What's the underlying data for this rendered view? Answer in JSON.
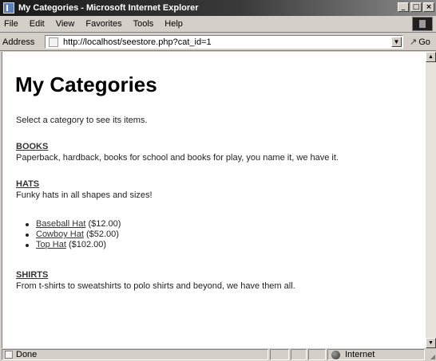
{
  "window": {
    "title": "My Categories - Microsoft Internet Explorer",
    "controls": {
      "minimize": "_",
      "maximize": "□",
      "close": "×"
    }
  },
  "menu": {
    "items": [
      {
        "label": "File"
      },
      {
        "label": "Edit"
      },
      {
        "label": "View"
      },
      {
        "label": "Favorites"
      },
      {
        "label": "Tools"
      },
      {
        "label": "Help"
      }
    ]
  },
  "address_bar": {
    "label": "Address",
    "url": "http://localhost/seestore.php?cat_id=1",
    "go_label": "Go",
    "dropdown_glyph": "▼"
  },
  "page": {
    "title": "My Categories",
    "intro": "Select a category to see its items.",
    "categories": [
      {
        "name": "BOOKS",
        "description": "Paperback, hardback, books for school and books for play, you name it, we have it."
      },
      {
        "name": "HATS",
        "description": "Funky hats in all shapes and sizes!",
        "items": [
          {
            "name": "Baseball Hat",
            "price": "($12.00)"
          },
          {
            "name": "Cowboy Hat",
            "price": "($52.00)"
          },
          {
            "name": "Top Hat",
            "price": "($102.00)"
          }
        ]
      },
      {
        "name": "SHIRTS",
        "description": "From t-shirts to sweatshirts to polo shirts and beyond, we have them all."
      }
    ]
  },
  "scrollbar": {
    "up_glyph": "▲",
    "down_glyph": "▼"
  },
  "status_bar": {
    "text": "Done",
    "zone": "Internet"
  }
}
